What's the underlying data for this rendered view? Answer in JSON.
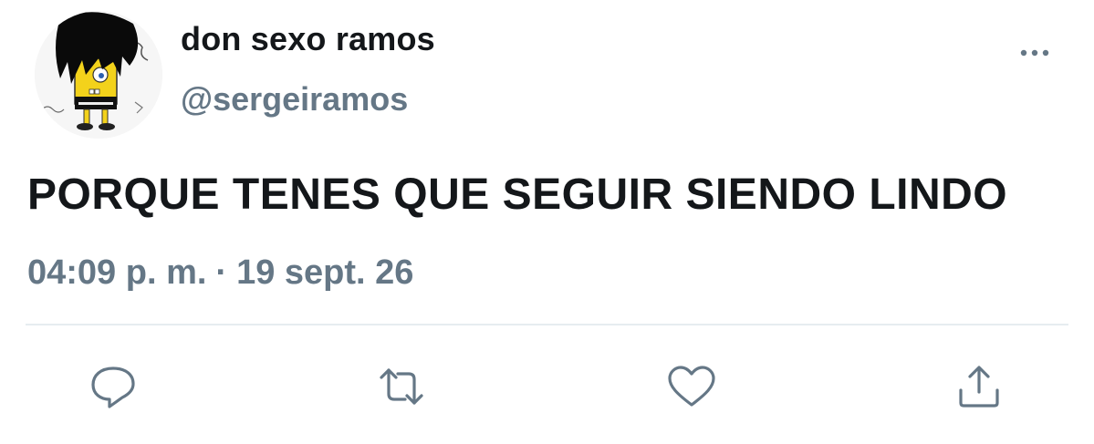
{
  "tweet": {
    "author": {
      "display_name": "don sexo ramos",
      "handle": "@sergeiramos"
    },
    "text": "PORQUE TENES QUE SEGUIR SIENDO LINDO",
    "time": "04:09 p. m.",
    "separator": "·",
    "date": "19 sept. 26"
  },
  "icons": {
    "more": "more-dots-icon",
    "reply": "reply-bubble-icon",
    "retweet": "retweet-arrows-icon",
    "like": "heart-icon",
    "share": "share-upload-icon"
  },
  "colors": {
    "text_primary": "#14171a",
    "text_secondary": "#657786",
    "icon": "#657786",
    "divider": "#e6ecf0"
  }
}
